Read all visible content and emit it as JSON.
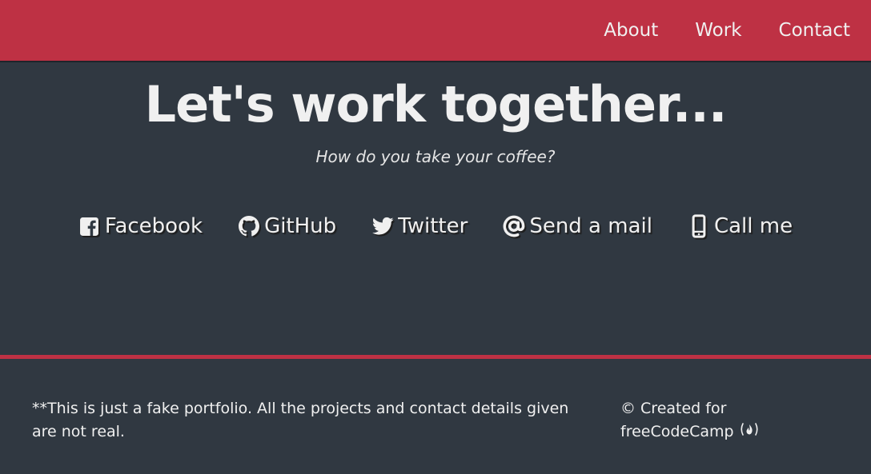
{
  "colors": {
    "primary": "#be3144",
    "background": "#303841",
    "text": "#f0f0f0"
  },
  "nav": {
    "items": [
      {
        "label": "About"
      },
      {
        "label": "Work"
      },
      {
        "label": "Contact"
      }
    ]
  },
  "contact": {
    "headline": "Let's work together...",
    "subline": "How do you take your coffee?",
    "links": [
      {
        "label": "Facebook",
        "icon": "facebook-square-icon"
      },
      {
        "label": "GitHub",
        "icon": "github-icon"
      },
      {
        "label": "Twitter",
        "icon": "twitter-icon"
      },
      {
        "label": "Send a mail",
        "icon": "at-icon"
      },
      {
        "label": "Call me",
        "icon": "mobile-phone-icon"
      }
    ]
  },
  "footer": {
    "note": "**This is just a fake portfolio. All the projects and contact details given are not real.",
    "credit_prefix": "© Created for",
    "credit_link": "freeCodeCamp",
    "credit_icon": "free-code-camp-icon"
  }
}
